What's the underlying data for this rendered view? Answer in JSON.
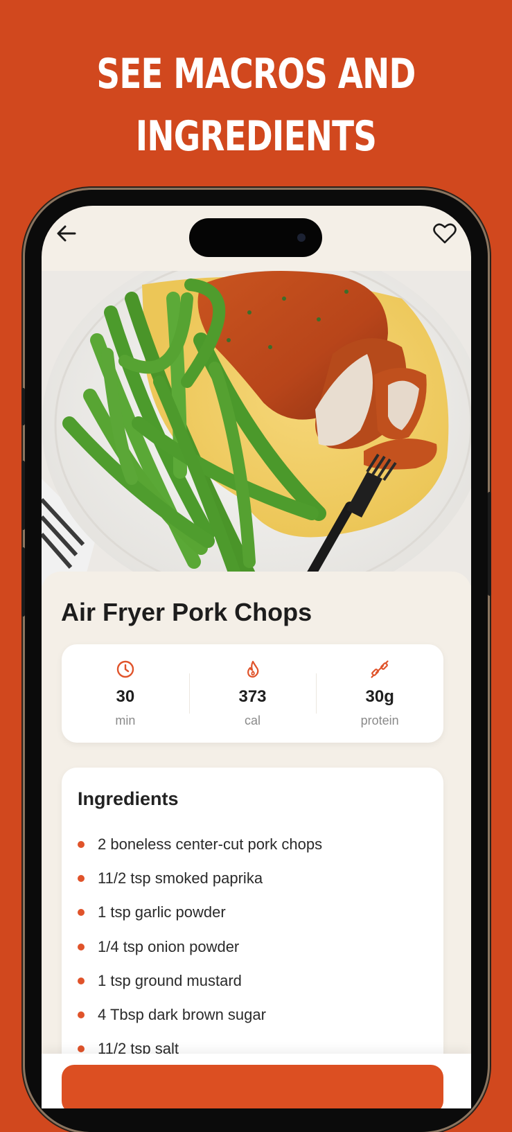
{
  "promo": {
    "headline_line1": "SEE MACROS AND",
    "headline_line2": "INGREDIENTS"
  },
  "colors": {
    "background": "#d1481e",
    "accent": "#e0532a",
    "card": "#ffffff",
    "screen": "#f4efe7"
  },
  "top_bar": {
    "back_icon": "arrow-left-icon",
    "favorite_icon": "heart-outline-icon"
  },
  "recipe": {
    "title": "Air Fryer Pork Chops",
    "stats": [
      {
        "icon": "clock-icon",
        "value": "30",
        "unit": "min"
      },
      {
        "icon": "flame-icon",
        "value": "373",
        "unit": "cal"
      },
      {
        "icon": "dumbbell-icon",
        "value": "30g",
        "unit": "protein"
      }
    ],
    "ingredients_heading": "Ingredients",
    "ingredients": [
      "2 boneless center-cut pork chops",
      "11/2 tsp smoked paprika",
      "1 tsp garlic powder",
      "1/4 tsp onion powder",
      "1 tsp ground mustard",
      "4 Tbsp dark brown sugar",
      "11/2 tsp salt"
    ]
  }
}
